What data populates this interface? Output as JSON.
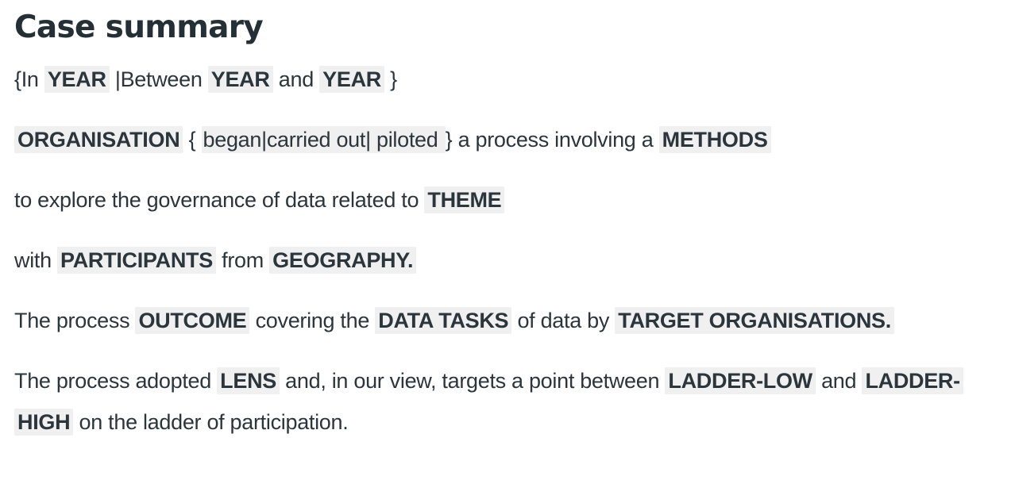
{
  "page": {
    "title": "Case summary",
    "highlight_color": "#f0f0f0",
    "text_color": "#2b353c",
    "heading_color": "#242f36",
    "background_color": "#ffffff"
  },
  "paragraphs": {
    "p1": {
      "open_brace": "{In ",
      "slot_year_1": "YEAR",
      "separator": " |Between ",
      "slot_year_2": "YEAR",
      "conjunction": " and ",
      "slot_year_3": "YEAR",
      "close_brace": " }"
    },
    "p2": {
      "slot_organisation": "ORGANISATION",
      "open_brace": " { ",
      "choice_verbs": " began|carried out| piloted ",
      "close_brace": "} ",
      "text_a": "a process involving a ",
      "slot_methods": "METHODS"
    },
    "p3": {
      "text_a": "to explore the governance of data related to ",
      "slot_theme": "THEME"
    },
    "p4": {
      "text_a": "with ",
      "slot_participants": "PARTICIPANTS",
      "text_b": " from ",
      "slot_geography": "GEOGRAPHY.",
      "text_c": ""
    },
    "p5": {
      "text_a": "The process ",
      "slot_outcome": "OUTCOME",
      "text_b": " covering the ",
      "slot_data_tasks": "DATA TASKS",
      "text_c": " of data by ",
      "slot_target_organisations": "TARGET ORGANISATIONS.",
      "text_d": ""
    },
    "p6": {
      "text_a": "The process adopted ",
      "slot_lens": "LENS",
      "text_b": " and, in our view, targets a point between ",
      "slot_ladder_low": "LADDER-LOW",
      "text_c": " and ",
      "slot_ladder_high": "LADDER-HIGH",
      "text_d": " on the ladder of participation."
    }
  }
}
